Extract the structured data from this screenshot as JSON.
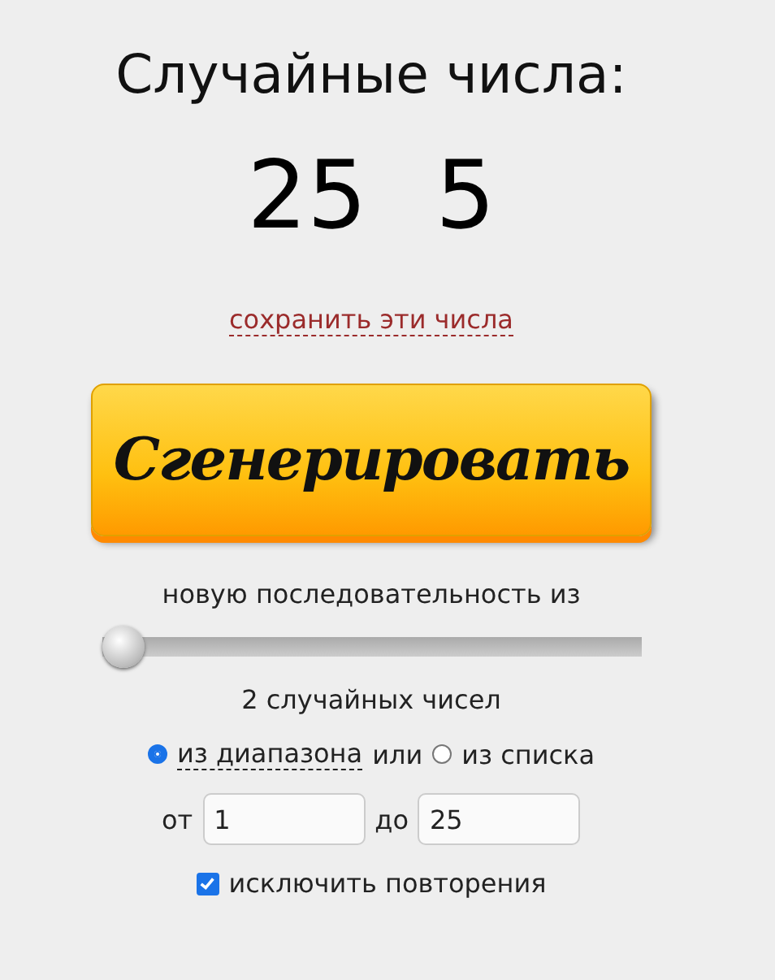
{
  "title": "Случайные числа:",
  "results": [
    "25",
    "5"
  ],
  "save_link": "сохранить эти числа",
  "generate_button": "Сгенерировать",
  "sequence_label": "новую последовательность из",
  "count_slider": {
    "level": 0.0
  },
  "count_label": "2 случайных чисел",
  "source": {
    "options": [
      {
        "label": "из диапазона",
        "selected": true,
        "kind": "link"
      },
      {
        "label": "из списка",
        "selected": false,
        "kind": "plain"
      }
    ],
    "connector": "или"
  },
  "range": {
    "from_label": "от",
    "from_value": "1",
    "to_label": "до",
    "to_value": "25"
  },
  "exclude_repeats": {
    "label": "исключить повторения",
    "checked": true
  }
}
